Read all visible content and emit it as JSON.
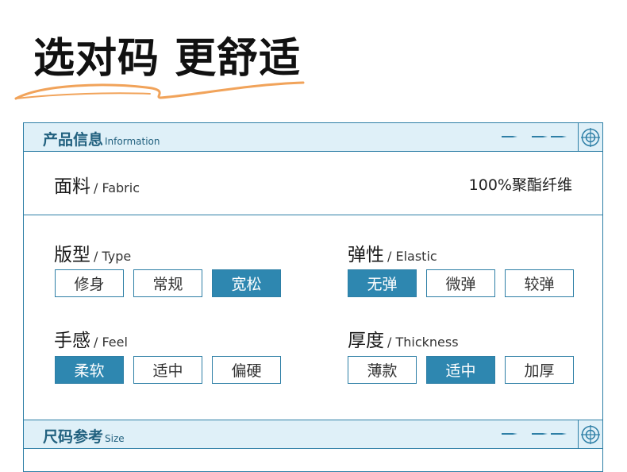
{
  "hero": {
    "title": "选对码 更舒适"
  },
  "colors": {
    "accent": "#2e7fa6",
    "selected_fill": "#2e87b0",
    "band_fill": "#dff0f8",
    "swoosh": "#f1a35a"
  },
  "info_band": {
    "title": "产品信息",
    "subtitle": "Information"
  },
  "fabric": {
    "label_cn": "面料",
    "label_en": "/ Fabric",
    "value": "100%聚酯纤维"
  },
  "groups": {
    "type": {
      "label_cn": "版型",
      "label_en": "/ Type",
      "options": [
        "修身",
        "常规",
        "宽松"
      ],
      "selected": 2
    },
    "elastic": {
      "label_cn": "弹性",
      "label_en": "/ Elastic",
      "options": [
        "无弹",
        "微弹",
        "较弹"
      ],
      "selected": 0
    },
    "feel": {
      "label_cn": "手感",
      "label_en": "/ Feel",
      "options": [
        "柔软",
        "适中",
        "偏硬"
      ],
      "selected": 0
    },
    "thickness": {
      "label_cn": "厚度",
      "label_en": "/ Thickness",
      "options": [
        "薄款",
        "适中",
        "加厚"
      ],
      "selected": 1
    }
  },
  "size_band": {
    "title": "尺码参考",
    "subtitle": "Size"
  },
  "icons": {
    "arrows": "triple-arrow-icon",
    "target": "crosshair-target-icon"
  }
}
